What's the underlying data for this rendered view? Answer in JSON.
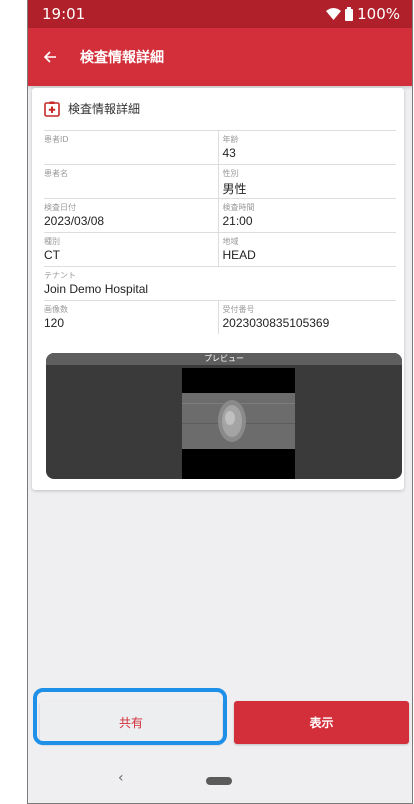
{
  "status_bar": {
    "time": "19:01",
    "battery": "100%"
  },
  "app_bar": {
    "title": "検査情報詳細"
  },
  "card": {
    "title": "検査情報詳細",
    "rows": [
      [
        {
          "label": "患者ID",
          "value": ""
        },
        {
          "label": "年齢",
          "value": "43"
        }
      ],
      [
        {
          "label": "患者名",
          "value": ""
        },
        {
          "label": "性別",
          "value": "男性"
        }
      ],
      [
        {
          "label": "検査日付",
          "value": "2023/03/08"
        },
        {
          "label": "検査時間",
          "value": "21:00"
        }
      ],
      [
        {
          "label": "種別",
          "value": "CT"
        },
        {
          "label": "地域",
          "value": "HEAD"
        }
      ],
      [
        {
          "label": "テナント",
          "value": "Join Demo Hospital"
        }
      ],
      [
        {
          "label": "画像数",
          "value": "120"
        },
        {
          "label": "受付番号",
          "value": "2023030835105369"
        }
      ]
    ]
  },
  "preview": {
    "label": "プレビュー"
  },
  "buttons": {
    "share": "共有",
    "view": "表示"
  },
  "nav": {
    "back": "‹"
  },
  "colors": {
    "primary": "#d32f3a",
    "status": "#b0202a",
    "highlight": "#1e90e8"
  }
}
